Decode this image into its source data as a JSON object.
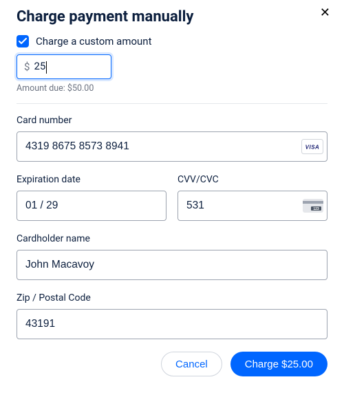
{
  "dialog": {
    "title": "Charge payment manually",
    "close_glyph": "✕"
  },
  "custom_amount": {
    "checkbox_checked": true,
    "label": "Charge a custom amount",
    "currency_symbol": "$",
    "value": "25",
    "amount_due_text": "Amount due: $50.00"
  },
  "card": {
    "number_label": "Card number",
    "number_value": "4319 8675 8573 8941",
    "brand": "visa",
    "exp_label": "Expiration date",
    "exp_value": "01 / 29",
    "cvv_label": "CVV/CVC",
    "cvv_value": "531",
    "name_label": "Cardholder name",
    "name_value": "John Macavoy",
    "zip_label": "Zip / Postal Code",
    "zip_value": "43191"
  },
  "footer": {
    "cancel": "Cancel",
    "charge": "Charge $25.00"
  }
}
